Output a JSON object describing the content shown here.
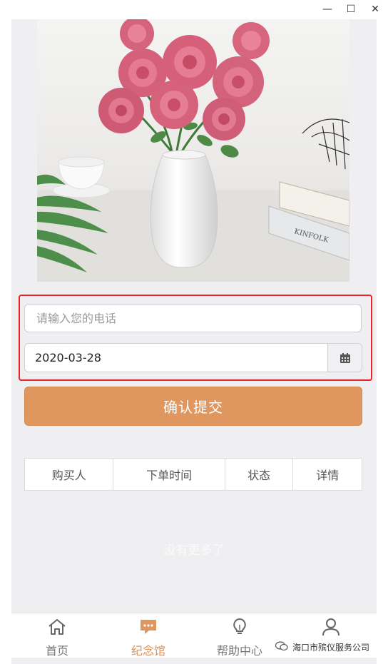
{
  "window": {
    "minimize_glyph": "—",
    "maximize_glyph": "☐",
    "close_glyph": "✕"
  },
  "form": {
    "phone_placeholder": "请输入您的电话",
    "phone_value": "",
    "date_value": "2020-03-28",
    "date_icon": "calendar-icon",
    "submit_label": "确认提交"
  },
  "table": {
    "headers": [
      "购买人",
      "下单时间",
      "状态",
      "详情"
    ]
  },
  "empty_text": "没有更多了",
  "tabbar": {
    "items": [
      {
        "label": "首页",
        "icon": "home-icon",
        "active": false
      },
      {
        "label": "纪念馆",
        "icon": "chat-bubble-icon",
        "active": true
      },
      {
        "label": "帮助中心",
        "icon": "lightbulb-icon",
        "active": false
      },
      {
        "label": "",
        "icon": "user-icon",
        "active": false
      }
    ]
  },
  "watermark": {
    "text": "海口市殡仪服务公司"
  },
  "colors": {
    "accent": "#df975f",
    "highlight_border": "#e8242a",
    "app_background": "#efeff1"
  }
}
